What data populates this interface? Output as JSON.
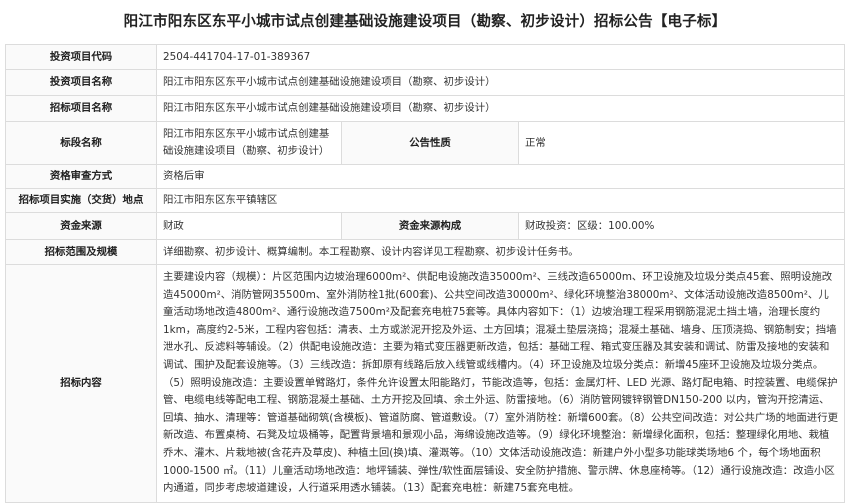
{
  "title": "阳江市阳东区东平小城市试点创建基础设施建设项目（勘察、初步设计）招标公告【电子标】",
  "rows": {
    "code": {
      "label": "投资项目代码",
      "value": "2504-441704-17-01-389367"
    },
    "invest_name": {
      "label": "投资项目名称",
      "value": "阳江市阳东区东平小城市试点创建基础设施建设项目（勘察、初步设计）"
    },
    "bid_name": {
      "label": "招标项目名称",
      "value": "阳江市阳东区东平小城市试点创建基础设施建设项目（勘察、初步设计）"
    },
    "section": {
      "label": "标段名称",
      "value": "阳江市阳东区东平小城市试点创建基础设施建设项目（勘察、初步设计）",
      "label2": "公告性质",
      "value2": "正常"
    },
    "qualification": {
      "label": "资格审查方式",
      "value": "资格后审"
    },
    "location": {
      "label": "招标项目实施（交货）地点",
      "value": "阳江市阳东区东平镇辖区"
    },
    "funding": {
      "label": "资金来源",
      "value": "财政",
      "label2": "资金来源构成",
      "value2": "财政投资：区级：100.00%"
    },
    "scope": {
      "label": "招标范围及规模",
      "value": "详细勘察、初步设计、概算编制。本工程勘察、设计内容详见工程勘察、初步设计任务书。"
    },
    "content": {
      "label": "招标内容",
      "value": "主要建设内容（规模）：片区范围内边坡治理6000m²、供配电设施改造35000m²、三线改造65000m、环卫设施及垃圾分类点45套、照明设施改造45000m²、消防管网35500m、室外消防栓1批(600套)、公共空间改造30000m²、绿化环境整治38000m²、文体活动设施改造8500m²、儿童活动场地改造4800m²、通行设施改造7500m²及配套充电桩75套等。具体内容如下：（1）边坡治理工程采用钢筋混泥土挡土墙，治理长度约1km，高度约2-5米，工程内容包括：清表、土方或淤泥开挖及外运、土方回填；混凝土垫层浇捣；混凝土基础、墙身、压顶浇捣、钢筋制安；挡墙泄水孔、反滤料等辅设。（2）供配电设施改造：主要为箱式变压器更新改造，包括：基础工程、箱式变压器及其安装和调试、防雷及接地的安装和调试、围护及配套设施等。（3）三线改造：拆卸原有线路后放入线管或线槽内。（4）环卫设施及垃圾分类点：新增45座环卫设施及垃圾分类点。（5）照明设施改造：主要设置单臂路灯，条件允许设置太阳能路灯，节能改造等，包括：金属灯杆、LED 光源、路灯配电箱、时控装置、电缆保护管、电缆电线等配电工程、钢筋混凝土基础、土方开挖及回填、余土外运、防雷接地。（6）消防管网镀锌钢管DN150-200 以内，管沟开挖清运、回填、抽水、清理等：管道基础砌筑(含模板)、管道防腐、管道敷设。（7）室外消防栓：新增600套。（8）公共空间改造：对公共广场的地面进行更新改造、布置桌椅、石凳及垃圾桶等，配置背景墙和景观小品，海绵设施改造等。（9）绿化环境整治：新增绿化面积，包括：整理绿化用地、栽植乔木、灌木、片栽地被(含花卉及草皮)、种植土回(换)填、灌溉等。（10）文体活动设施改造：新建户外小型多功能球类场地6 个，每个场地面积1000-1500 ㎡。（11）儿童活动场地改造：地坪铺装、弹性/软性面层铺设、安全防护措施、警示牌、休息座椅等。（12）通行设施改造：改造小区内通道，同步考虑坡道建设，人行道采用透水铺装。（13）配套充电桩：新建75套充电桩。"
    }
  }
}
